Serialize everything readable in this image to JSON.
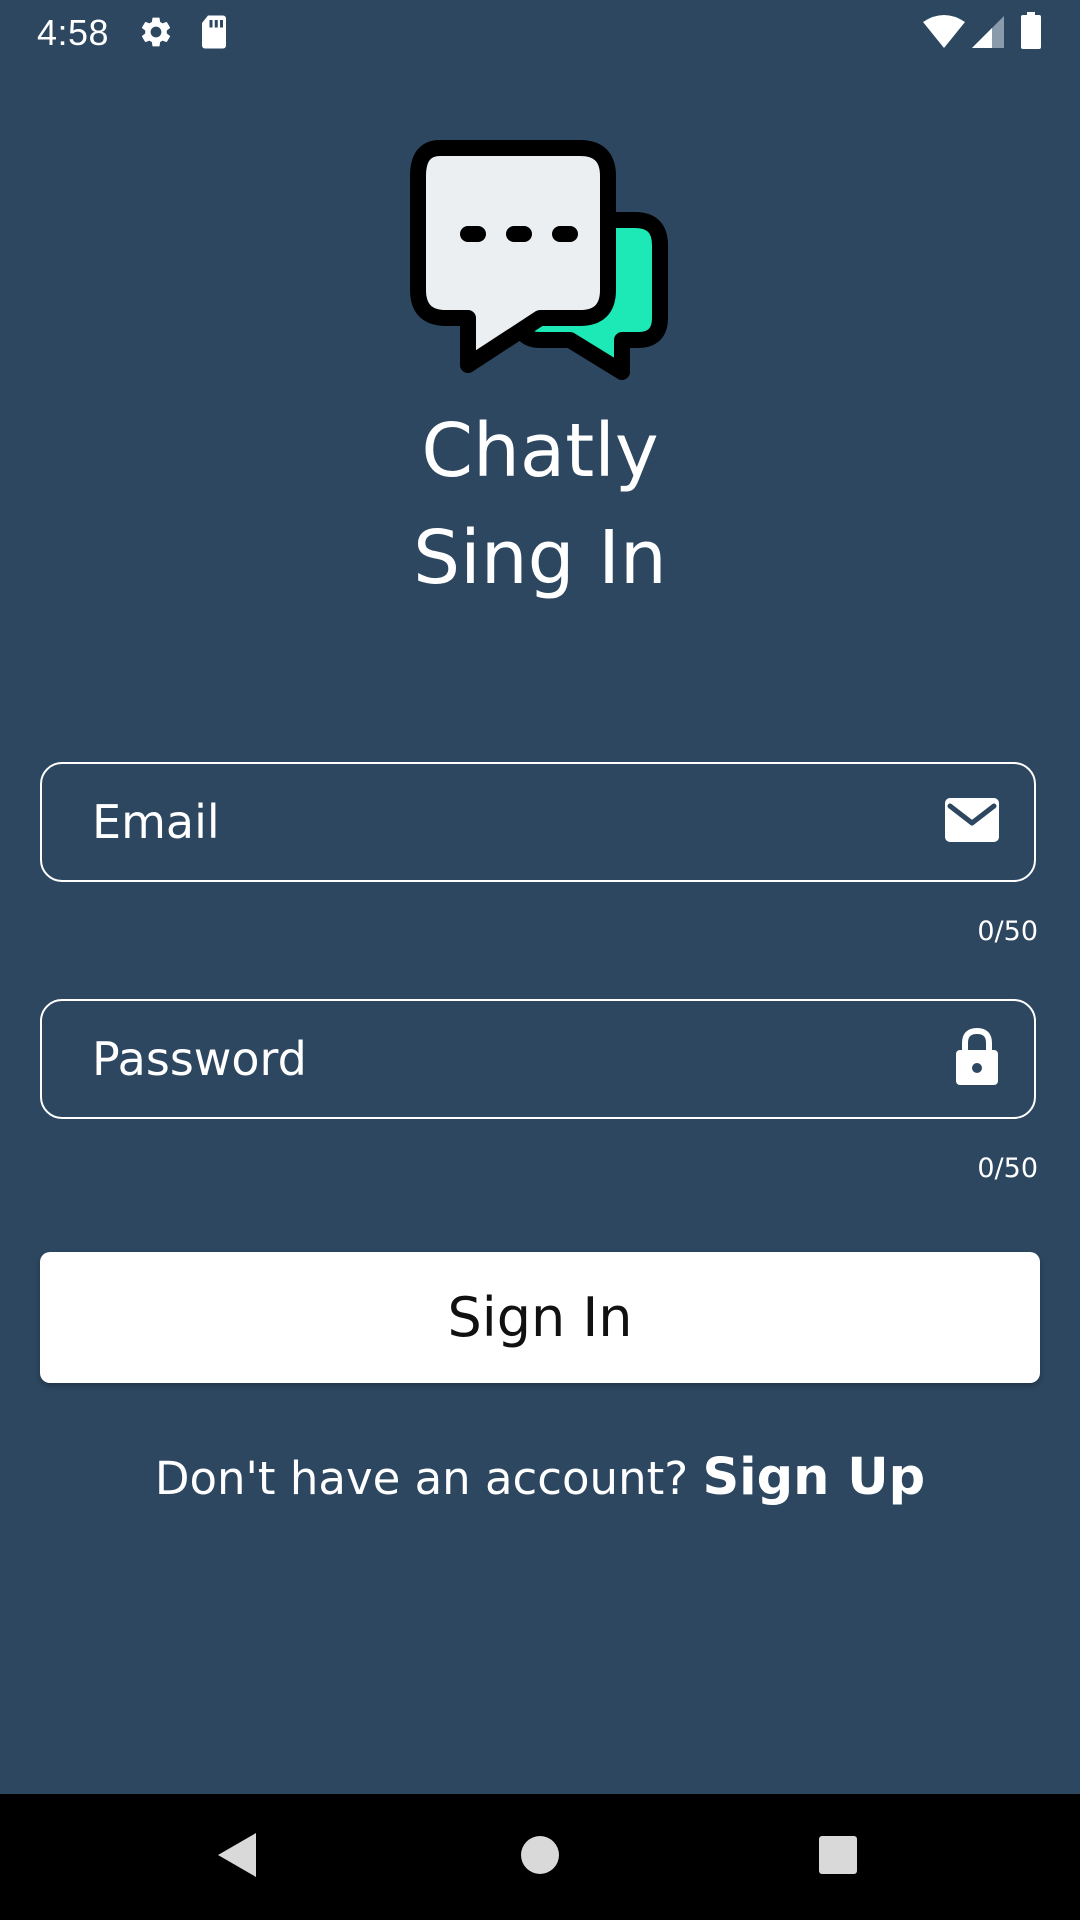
{
  "status_bar": {
    "time": "4:58",
    "icons": [
      "gear-icon",
      "sd-card-icon",
      "wifi-icon",
      "signal-icon",
      "battery-icon"
    ]
  },
  "app": {
    "name": "Chatly",
    "page_title": "Sing In",
    "logo": "chat-bubbles-logo"
  },
  "form": {
    "email_placeholder": "Email",
    "email_counter": "0/50",
    "email_icon": "envelope-icon",
    "password_placeholder": "Password",
    "password_counter": "0/50",
    "password_icon": "lock-icon"
  },
  "actions": {
    "sign_in_label": "Sign In",
    "signup_prompt": "Don't have an account?",
    "signup_link": "Sign Up"
  },
  "nav_bar": {
    "buttons": [
      "back-icon",
      "home-icon",
      "recents-icon"
    ]
  },
  "colors": {
    "background": "#2d4760",
    "logo_accent": "#1de9b6",
    "logo_bubble": "#eceff1",
    "button_bg": "#ffffff"
  }
}
